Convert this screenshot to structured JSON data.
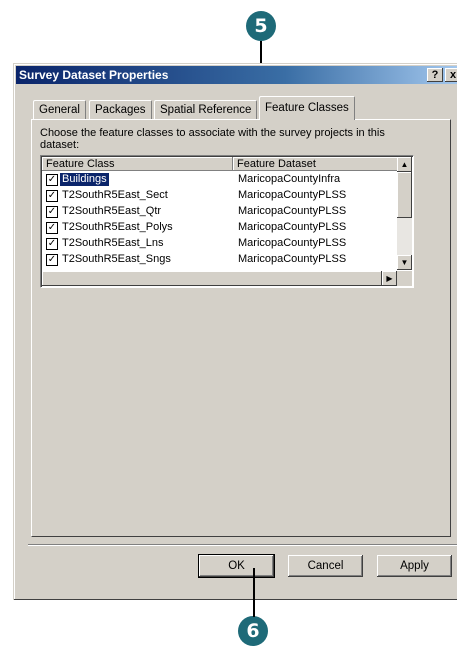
{
  "callouts": {
    "top": "5",
    "bottom": "6"
  },
  "window": {
    "title": "Survey Dataset Properties",
    "help_button": "?",
    "close_button": "x"
  },
  "tabs": [
    {
      "label": "General"
    },
    {
      "label": "Packages"
    },
    {
      "label": "Spatial Reference"
    },
    {
      "label": "Feature Classes",
      "active": true
    }
  ],
  "panel": {
    "prompt": "Choose the feature classes to associate with the survey projects in this dataset:",
    "columns": [
      "Feature Class",
      "Feature Dataset"
    ],
    "rows": [
      {
        "checked": true,
        "feature_class": "Buildings",
        "feature_dataset": "MaricopaCountyInfra",
        "selected": true
      },
      {
        "checked": true,
        "feature_class": "T2SouthR5East_Sect",
        "feature_dataset": "MaricopaCountyPLSS"
      },
      {
        "checked": true,
        "feature_class": "T2SouthR5East_Qtr",
        "feature_dataset": "MaricopaCountyPLSS"
      },
      {
        "checked": true,
        "feature_class": "T2SouthR5East_Polys",
        "feature_dataset": "MaricopaCountyPLSS"
      },
      {
        "checked": true,
        "feature_class": "T2SouthR5East_Lns",
        "feature_dataset": "MaricopaCountyPLSS"
      },
      {
        "checked": true,
        "feature_class": "T2SouthR5East_Sngs",
        "feature_dataset": "MaricopaCountyPLSS"
      }
    ]
  },
  "buttons": {
    "ok": "OK",
    "cancel": "Cancel",
    "apply": "Apply"
  },
  "icons": {
    "check": "✓",
    "scroll_up": "▲",
    "scroll_down": "▼",
    "scroll_right": "▶"
  }
}
